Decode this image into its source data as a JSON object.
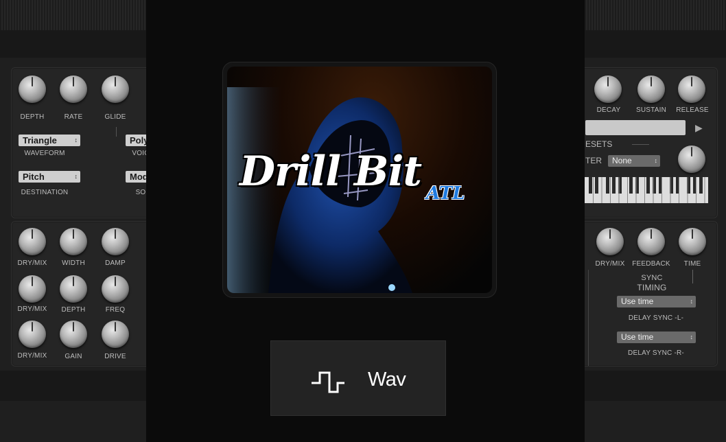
{
  "left_panel": {
    "lfo_knobs": [
      "DEPTH",
      "RATE",
      "GLIDE"
    ],
    "waveform_select": "Triangle",
    "waveform_label": "WAVEFORM",
    "destination_select": "Pitch",
    "destination_label": "DESTINATION",
    "voice_select": "Poly",
    "voice_label": "VOIC",
    "source_select": "Mod",
    "source_label": "SO",
    "fx_row1": [
      "DRY/MIX",
      "WIDTH",
      "DAMP"
    ],
    "fx_row2": [
      "DRY/MIX",
      "DEPTH",
      "FREQ"
    ],
    "fx_row3": [
      "DRY/MIX",
      "GAIN",
      "DRIVE"
    ]
  },
  "right_panel": {
    "env_knobs": [
      "DECAY",
      "SUSTAIN",
      "RELEASE"
    ],
    "presets_label": "ESETS",
    "filter_label": "TER",
    "filter_select": "None",
    "delay_knobs": [
      "DRY/MIX",
      "FEEDBACK",
      "TIME"
    ],
    "sync_label": "SYNC",
    "timing_label": "TIMING",
    "delay_l_select": "Use time",
    "delay_l_label": "DELAY SYNC -L-",
    "delay_r_select": "Use time",
    "delay_r_label": "DELAY SYNC -R-"
  },
  "modal": {
    "artwork_title": "Drill Bit",
    "artwork_subtitle": "ATL",
    "format_button_label": "Wav",
    "format_icon": "square-wave-icon"
  }
}
